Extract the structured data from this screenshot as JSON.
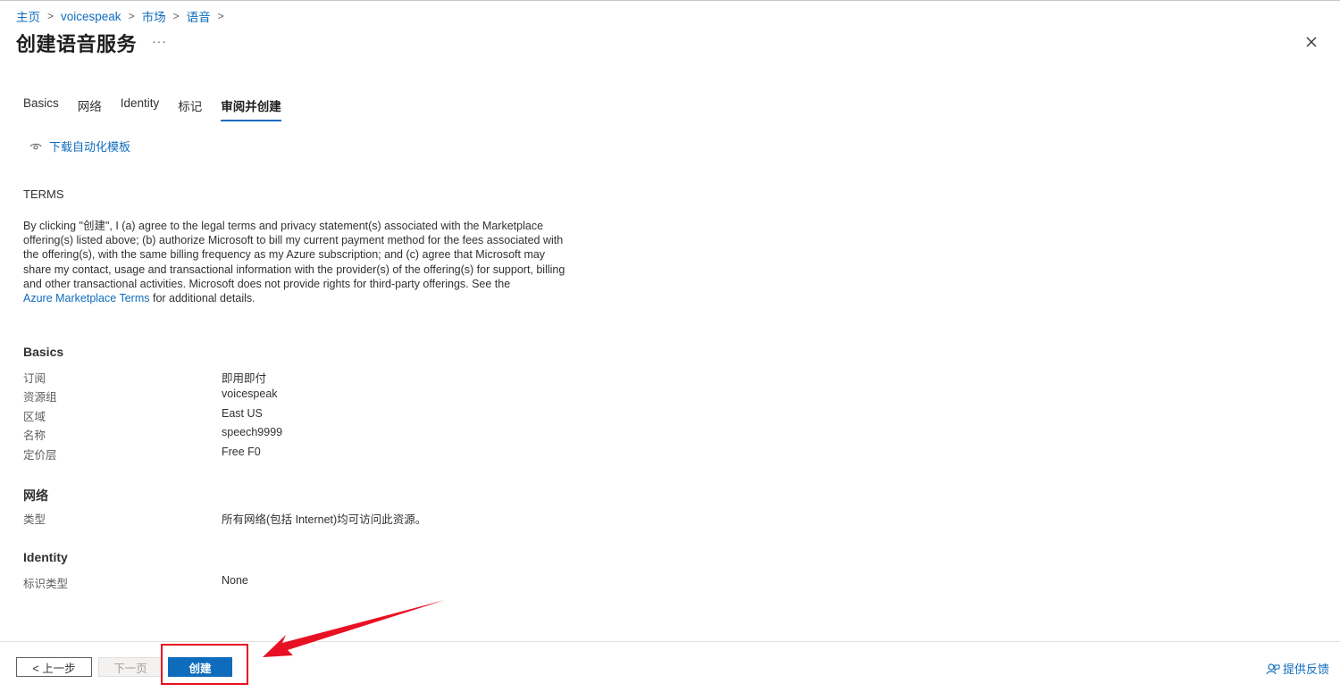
{
  "breadcrumb": {
    "items": [
      "主页",
      "voicespeak",
      "市场",
      "语音"
    ]
  },
  "header": {
    "title": "创建语音服务",
    "more_label": "···"
  },
  "tabs": [
    {
      "label": "Basics",
      "active": false
    },
    {
      "label": "网络",
      "active": false
    },
    {
      "label": "Identity",
      "active": false
    },
    {
      "label": "标记",
      "active": false
    },
    {
      "label": "审阅并创建",
      "active": true
    }
  ],
  "download_template": {
    "label": "下载自动化模板",
    "icon": "eye-icon"
  },
  "terms": {
    "title": "TERMS",
    "text_before_link": "By clicking \"创建\", I (a) agree to the legal terms and privacy statement(s) associated with the Marketplace offering(s) listed above; (b) authorize Microsoft to bill my current payment method for the fees associated with the offering(s), with the same billing frequency as my Azure subscription; and (c) agree that Microsoft may share my contact, usage and transactional information with the provider(s) of the offering(s) for support, billing and other transactional activities. Microsoft does not provide rights for third-party offerings. See the",
    "link_text": "Azure Marketplace Terms",
    "text_after_link": " for additional details."
  },
  "sections": {
    "basics": {
      "title": "Basics",
      "rows": [
        {
          "label": "订阅",
          "value": "即用即付"
        },
        {
          "label": "资源组",
          "value": "voicespeak"
        },
        {
          "label": "区域",
          "value": "East US"
        },
        {
          "label": "名称",
          "value": "speech9999"
        },
        {
          "label": "定价层",
          "value": "Free F0"
        }
      ]
    },
    "network": {
      "title": "网络",
      "rows": [
        {
          "label": "类型",
          "value": "所有网络(包括 Internet)均可访问此资源。"
        }
      ]
    },
    "identity": {
      "title": "Identity",
      "rows": [
        {
          "label": "标识类型",
          "value": "None"
        }
      ]
    }
  },
  "footer": {
    "prev_label": "< 上一步",
    "next_label": "下一页",
    "create_label": "创建",
    "feedback_label": "提供反馈"
  },
  "colors": {
    "accent": "#0f6cbd",
    "annotation": "#e81123"
  }
}
